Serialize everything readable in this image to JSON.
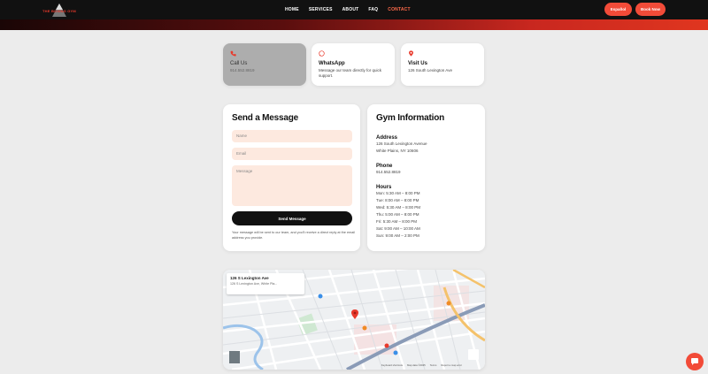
{
  "header": {
    "logo_text": "THE BOXING GYM",
    "nav": [
      {
        "label": "HOME"
      },
      {
        "label": "SERVICES"
      },
      {
        "label": "ABOUT"
      },
      {
        "label": "FAQ"
      },
      {
        "label": "CONTACT",
        "active": true
      }
    ],
    "buttons": {
      "primary": "Español",
      "secondary": "Book Now"
    },
    "accent": "#f24b38"
  },
  "contact_cards": [
    {
      "icon": "phone-icon",
      "title": "Call Us",
      "subtitle": "914.552.8819"
    },
    {
      "icon": "whatsapp-icon",
      "title": "WhatsApp",
      "subtitle": "Message our team directly for quick support."
    },
    {
      "icon": "location-pin-icon",
      "title": "Visit Us",
      "subtitle": "126 South Lexington Ave"
    }
  ],
  "form": {
    "title": "Send a Message",
    "name_placeholder": "Name",
    "email_placeholder": "Email",
    "message_placeholder": "Message",
    "submit_label": "Send Message",
    "note": "Your message will be sent to our team, and you'll receive a direct reply at the email address you provide."
  },
  "info": {
    "title": "Gym Information",
    "address_heading": "Address",
    "address_line1": "126 South Lexington Avenue",
    "address_line2": "White Plains, NY 10606",
    "phone_heading": "Phone",
    "phone": "914.552.8819",
    "hours_heading": "Hours",
    "hours": [
      "Mon: 5:30 AM – 8:00 PM",
      "Tue: 8:00 AM – 8:00 PM",
      "Wed: 5:30 AM – 8:00 PM",
      "Thu: 5:00 AM – 8:00 PM",
      "Fri: 5:30 AM – 8:00 PM",
      "Sat: 9:00 AM – 10:00 AM",
      "Sun: 9:00 AM – 2:00 PM"
    ]
  },
  "map": {
    "place_title": "126 S Lexington Ave",
    "place_address": "126 S Lexington Ave, White Pla...",
    "attribution": [
      "Keyboard shortcuts",
      "Map data ©2025",
      "Terms",
      "Report a map error"
    ]
  }
}
